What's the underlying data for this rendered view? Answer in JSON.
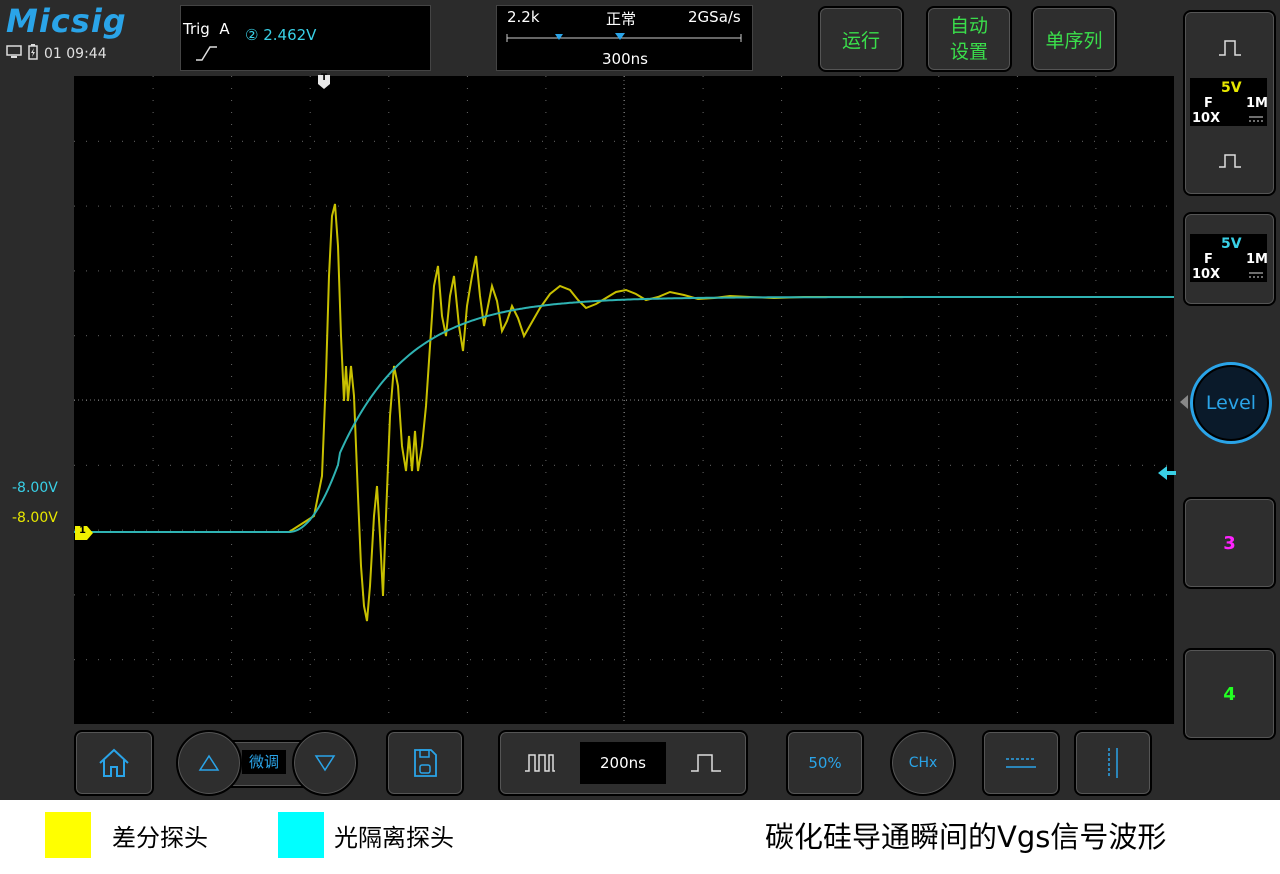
{
  "app": {
    "logo": "Micsig",
    "clock": "01 09:44"
  },
  "trigger": {
    "label": "Trig",
    "channel": "A",
    "source_value": "② 2.462V"
  },
  "timebase": {
    "memory": "2.2k",
    "mode": "正常",
    "sample_rate": "2GSa/s",
    "horizontal_position": "300ns"
  },
  "top_buttons": {
    "run": "运行",
    "auto_setup_line1": "自动",
    "auto_setup_line2": "设置",
    "single": "单序列"
  },
  "channels": {
    "ch1": {
      "scale": "5V",
      "coupling": "F",
      "impedance": "1M",
      "probe": "10X",
      "color": "#ffff00"
    },
    "ch2": {
      "scale": "5V",
      "coupling": "F",
      "impedance": "1M",
      "probe": "10X",
      "color": "#00ffff"
    },
    "ch3": {
      "label": "3",
      "color": "#ff22ff"
    },
    "ch4": {
      "label": "4",
      "color": "#22ff22"
    }
  },
  "offsets": {
    "ch2_offset": "-8.00V",
    "ch1_offset": "-8.00V",
    "ch1_marker": "1",
    "trigger_marker": "T"
  },
  "level_button": "Level",
  "bottom_bar": {
    "fine_label": "微调",
    "timebase_value": "200ns",
    "fifty_percent": "50%",
    "chx": "CHx"
  },
  "legend": {
    "yellow_label": "差分探头",
    "yellow_color": "#ffff00",
    "cyan_label": "光隔离探头",
    "cyan_color": "#00ffff",
    "caption": "碳化硅导通瞬间的Vgs信号波形"
  }
}
